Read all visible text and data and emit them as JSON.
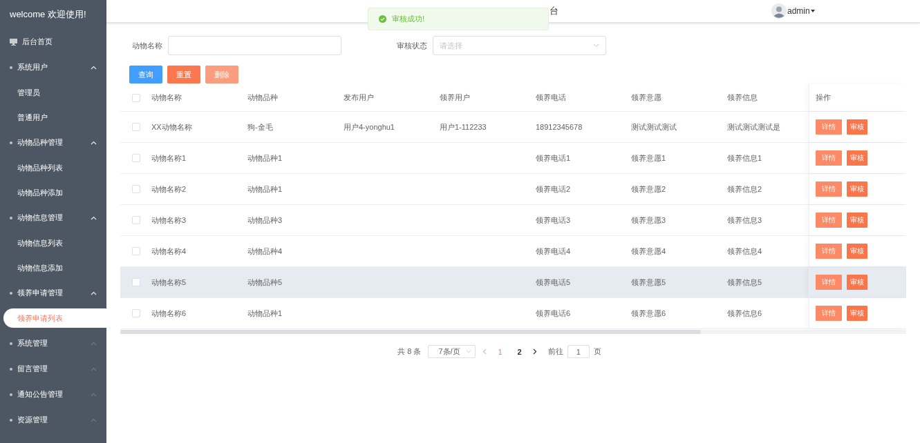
{
  "sidebar": {
    "title": "welcome 欢迎使用!",
    "items": [
      {
        "kind": "link",
        "label": "后台首页"
      },
      {
        "kind": "group",
        "label": "系统用户",
        "expanded": true,
        "children": [
          {
            "label": "管理员",
            "selected": false
          },
          {
            "label": "普通用户",
            "selected": false
          }
        ]
      },
      {
        "kind": "group",
        "label": "动物品种管理",
        "expanded": true,
        "children": [
          {
            "label": "动物品种列表",
            "selected": false
          },
          {
            "label": "动物品种添加",
            "selected": false
          }
        ]
      },
      {
        "kind": "group",
        "label": "动物信息管理",
        "expanded": true,
        "children": [
          {
            "label": "动物信息列表",
            "selected": false
          },
          {
            "label": "动物信息添加",
            "selected": false
          }
        ]
      },
      {
        "kind": "group",
        "label": "领养申请管理",
        "expanded": true,
        "children": [
          {
            "label": "领养申请列表",
            "selected": true
          }
        ]
      },
      {
        "kind": "group",
        "label": "系统管理",
        "expanded": false
      },
      {
        "kind": "group",
        "label": "留言管理",
        "expanded": false
      },
      {
        "kind": "group",
        "label": "通知公告管理",
        "expanded": false
      },
      {
        "kind": "group",
        "label": "资源管理",
        "expanded": false
      }
    ]
  },
  "header": {
    "title": "台",
    "user": "admin"
  },
  "toast": {
    "message": "审核成功!"
  },
  "filters": [
    {
      "kind": "input",
      "label": "动物名称"
    },
    {
      "kind": "select",
      "label": "审核状态",
      "placeholder": "请选择"
    }
  ],
  "buttons": [
    {
      "kind": "primary",
      "label": "查询",
      "disabled": false
    },
    {
      "kind": "danger",
      "label": "重置",
      "disabled": false
    },
    {
      "kind": "danger",
      "label": "删除",
      "disabled": true
    }
  ],
  "table": {
    "checked": false,
    "columns": [
      "动物名称",
      "动物品种",
      "发布用户",
      "领养用户",
      "领养电话",
      "领养意愿",
      "领养信息",
      "操作"
    ],
    "rows": [
      {
        "checked": false,
        "highlighted": false,
        "cells": [
          "XX动物名称",
          "狗-金毛",
          "用户4-yonghu1",
          "用户1-112233",
          "18912345678",
          "测试测试测试",
          "测试测试测试是"
        ],
        "actions": [
          "详情",
          "审核"
        ]
      },
      {
        "checked": false,
        "highlighted": false,
        "cells": [
          "动物名称1",
          "动物品种1",
          "",
          "",
          "领养电话1",
          "领养意愿1",
          "领养信息1"
        ],
        "actions": [
          "详情",
          "审核"
        ]
      },
      {
        "checked": false,
        "highlighted": false,
        "cells": [
          "动物名称2",
          "动物品种1",
          "",
          "",
          "领养电话2",
          "领养意愿2",
          "领养信息2"
        ],
        "actions": [
          "详情",
          "审核"
        ]
      },
      {
        "checked": false,
        "highlighted": false,
        "cells": [
          "动物名称3",
          "动物品种3",
          "",
          "",
          "领养电话3",
          "领养意愿3",
          "领养信息3"
        ],
        "actions": [
          "详情",
          "审核"
        ]
      },
      {
        "checked": false,
        "highlighted": false,
        "cells": [
          "动物名称4",
          "动物品种4",
          "",
          "",
          "领养电话4",
          "领养意愿4",
          "领养信息4"
        ],
        "actions": [
          "详情",
          "审核"
        ]
      },
      {
        "checked": false,
        "highlighted": true,
        "cells": [
          "动物名称5",
          "动物品种5",
          "",
          "",
          "领养电话5",
          "领养意愿5",
          "领养信息5"
        ],
        "actions": [
          "详情",
          "审核"
        ]
      },
      {
        "checked": false,
        "highlighted": false,
        "cells": [
          "动物名称6",
          "动物品种1",
          "",
          "",
          "领养电话6",
          "领养意愿6",
          "领养信息6"
        ],
        "actions": [
          "详情",
          "审核"
        ]
      }
    ]
  },
  "pagination": {
    "total": "共 8 条",
    "page_size": "7条/页",
    "pages": [
      {
        "label": "1",
        "selected": true
      },
      {
        "label": "2",
        "selected": false
      }
    ],
    "goto_label": "前往",
    "goto_value": "1",
    "goto_suffix": "页"
  }
}
